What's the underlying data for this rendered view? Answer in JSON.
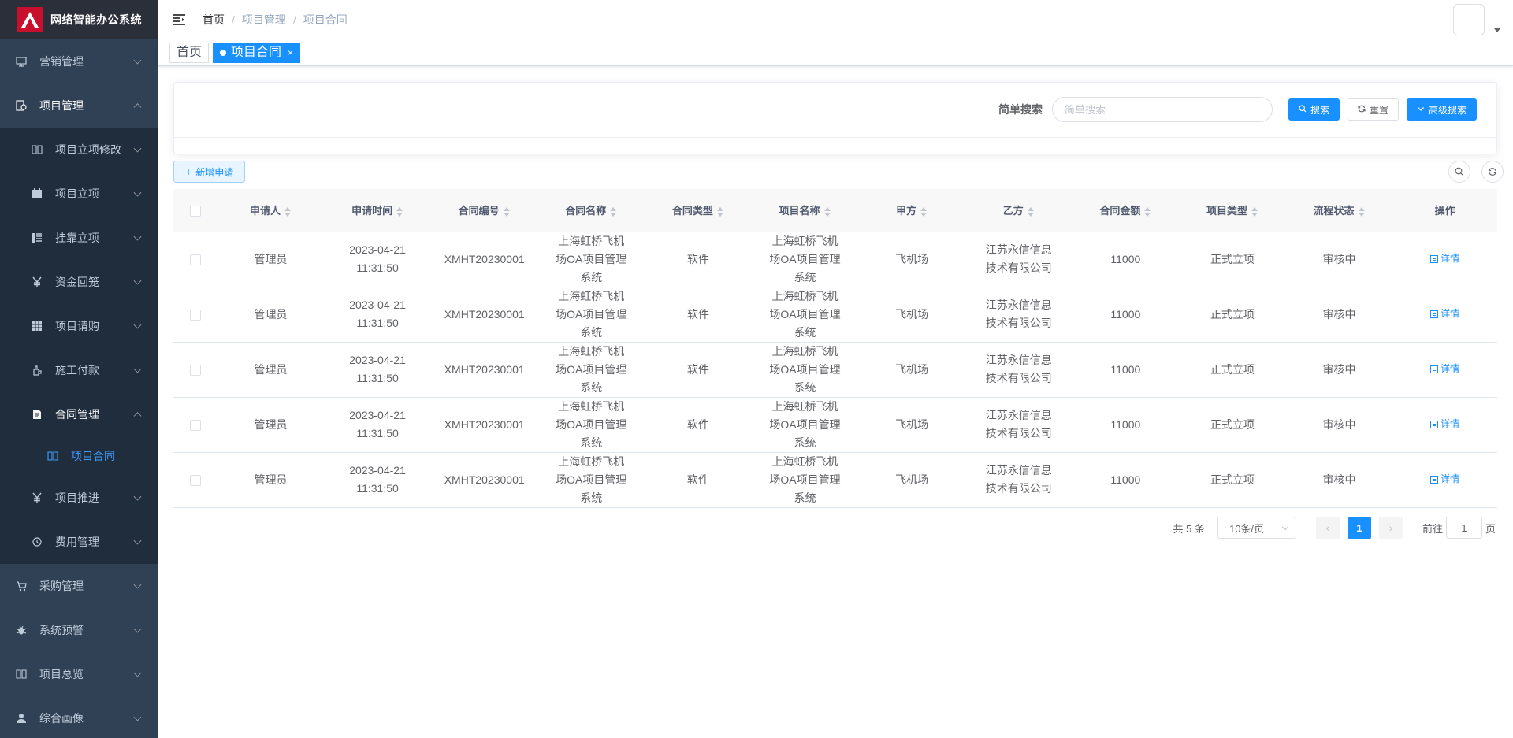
{
  "app": {
    "title": "网络智能办公系统"
  },
  "sidebar": {
    "items": [
      {
        "label": "营销管理",
        "icon": "monitor-icon",
        "expanded": false
      },
      {
        "label": "项目管理",
        "icon": "project-icon",
        "expanded": true
      },
      {
        "label": "采购管理",
        "icon": "cart-icon",
        "expanded": false
      },
      {
        "label": "系统预警",
        "icon": "bug-icon",
        "expanded": false
      },
      {
        "label": "项目总览",
        "icon": "book-icon",
        "expanded": false
      },
      {
        "label": "综合画像",
        "icon": "user-icon",
        "expanded": false
      }
    ],
    "project_sub": [
      {
        "label": "项目立项修改",
        "icon": "book-icon"
      },
      {
        "label": "项目立项",
        "icon": "calendar-icon"
      },
      {
        "label": "挂靠立项",
        "icon": "list-icon"
      },
      {
        "label": "资金回笼",
        "icon": "yen-icon"
      },
      {
        "label": "项目请购",
        "icon": "table-icon"
      },
      {
        "label": "施工付款",
        "icon": "payment-icon"
      },
      {
        "label": "合同管理",
        "icon": "document-icon",
        "expanded": true
      },
      {
        "label": "项目推进",
        "icon": "yen-icon"
      },
      {
        "label": "费用管理",
        "icon": "expense-icon"
      }
    ],
    "contract_sub": [
      {
        "label": "项目合同",
        "icon": "book-icon",
        "active": true
      }
    ]
  },
  "header": {
    "breadcrumb": [
      "首页",
      "项目管理",
      "项目合同"
    ]
  },
  "tags": [
    {
      "label": "首页",
      "active": false
    },
    {
      "label": "项目合同",
      "active": true,
      "close": "×"
    }
  ],
  "search": {
    "label": "简单搜索",
    "placeholder": "简单搜索",
    "value": "",
    "search_btn": "搜索",
    "reset_btn": "重置",
    "advanced_btn": "高级搜索"
  },
  "toolbar": {
    "add_btn": "新增申请"
  },
  "table": {
    "columns": [
      "申请人",
      "申请时间",
      "合同编号",
      "合同名称",
      "合同类型",
      "项目名称",
      "甲方",
      "乙方",
      "合同金额",
      "项目类型",
      "流程状态",
      "操作"
    ],
    "rows": [
      {
        "applicant": "管理员",
        "time": "2023-04-21 11:31:50",
        "code": "XMHT20230001",
        "contract_name": "上海虹桥飞机场OA项目管理系统",
        "contract_type": "软件",
        "project_name": "上海虹桥飞机场OA项目管理系统",
        "party_a": "飞机场",
        "party_b": "江苏永信信息技术有限公司",
        "amount": "11000",
        "project_type": "正式立项",
        "status": "审核中",
        "action": "详情"
      },
      {
        "applicant": "管理员",
        "time": "2023-04-21 11:31:50",
        "code": "XMHT20230001",
        "contract_name": "上海虹桥飞机场OA项目管理系统",
        "contract_type": "软件",
        "project_name": "上海虹桥飞机场OA项目管理系统",
        "party_a": "飞机场",
        "party_b": "江苏永信信息技术有限公司",
        "amount": "11000",
        "project_type": "正式立项",
        "status": "审核中",
        "action": "详情"
      },
      {
        "applicant": "管理员",
        "time": "2023-04-21 11:31:50",
        "code": "XMHT20230001",
        "contract_name": "上海虹桥飞机场OA项目管理系统",
        "contract_type": "软件",
        "project_name": "上海虹桥飞机场OA项目管理系统",
        "party_a": "飞机场",
        "party_b": "江苏永信信息技术有限公司",
        "amount": "11000",
        "project_type": "正式立项",
        "status": "审核中",
        "action": "详情"
      },
      {
        "applicant": "管理员",
        "time": "2023-04-21 11:31:50",
        "code": "XMHT20230001",
        "contract_name": "上海虹桥飞机场OA项目管理系统",
        "contract_type": "软件",
        "project_name": "上海虹桥飞机场OA项目管理系统",
        "party_a": "飞机场",
        "party_b": "江苏永信信息技术有限公司",
        "amount": "11000",
        "project_type": "正式立项",
        "status": "审核中",
        "action": "详情"
      },
      {
        "applicant": "管理员",
        "time": "2023-04-21 11:31:50",
        "code": "XMHT20230001",
        "contract_name": "上海虹桥飞机场OA项目管理系统",
        "contract_type": "软件",
        "project_name": "上海虹桥飞机场OA项目管理系统",
        "party_a": "飞机场",
        "party_b": "江苏永信信息技术有限公司",
        "amount": "11000",
        "project_type": "正式立项",
        "status": "审核中",
        "action": "详情"
      }
    ]
  },
  "pagination": {
    "total": "共 5 条",
    "page_size": "10条/页",
    "current": "1",
    "jump_prefix": "前往",
    "jump_value": "1",
    "jump_suffix": "页"
  },
  "colors": {
    "sidebar_bg": "#304156",
    "primary": "#1890ff",
    "active_menu": "#409eff",
    "logo_red": "#c8102e"
  }
}
